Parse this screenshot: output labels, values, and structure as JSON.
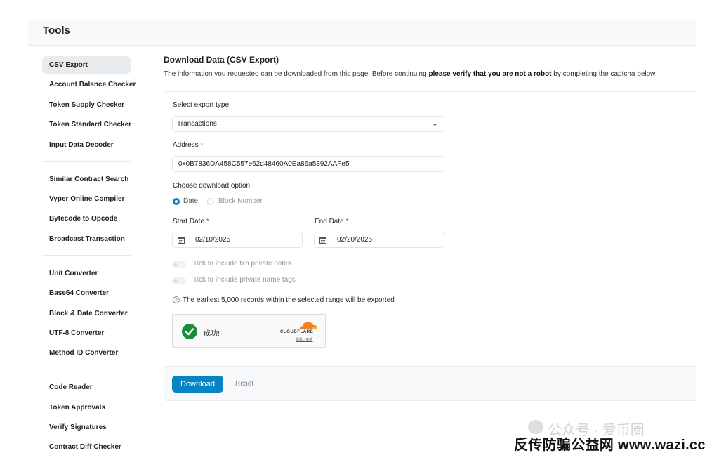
{
  "header": {
    "title": "Tools"
  },
  "sidebar": {
    "groups": [
      [
        "CSV Export",
        "Account Balance Checker",
        "Token Supply Checker",
        "Token Standard Checker",
        "Input Data Decoder"
      ],
      [
        "Similar Contract Search",
        "Vyper Online Compiler",
        "Bytecode to Opcode",
        "Broadcast Transaction"
      ],
      [
        "Unit Converter",
        "Base64 Converter",
        "Block & Date Converter",
        "UTF-8 Converter",
        "Method ID Converter"
      ],
      [
        "Code Reader",
        "Token Approvals",
        "Verify Signatures",
        "Contract Diff Checker"
      ]
    ],
    "active": "CSV Export"
  },
  "main": {
    "heading": "Download Data (CSV Export)",
    "desc_before": "The information you requested can be downloaded from this page. Before continuing ",
    "desc_bold": "please verify that you are not a robot",
    "desc_after": " by completing the captcha below."
  },
  "form": {
    "export_type_label": "Select export type",
    "export_type_value": "Transactions",
    "address_label": "Address",
    "address_value": "0x0B7836DA458C557e62d48460A0Ea86a5392AAFe5",
    "download_option_label": "Choose download option:",
    "option_date": "Date",
    "option_block": "Block Number",
    "start_date_label": "Start Date",
    "start_date_value": "02/10/2025",
    "end_date_label": "End Date",
    "end_date_value": "02/20/2025",
    "required_mark": "*",
    "toggle_notes": "Tick to include txn private notes",
    "toggle_tags": "Tick to include private name tags",
    "info_text": "The earliest 5,000 records within the selected range will be exported"
  },
  "captcha": {
    "status": "成功!",
    "brand": "CLOUDFLARE",
    "links": "隐私 · 条款"
  },
  "actions": {
    "download": "Download",
    "reset": "Reset"
  },
  "watermark": {
    "line1": "公众号 · 爱币圈",
    "line2": "反传防骗公益网 www.wazi.cc"
  },
  "colors": {
    "primary": "#0784c3",
    "success": "#1a8d3c",
    "required": "#de4437",
    "cloudflare": "#f38020"
  }
}
